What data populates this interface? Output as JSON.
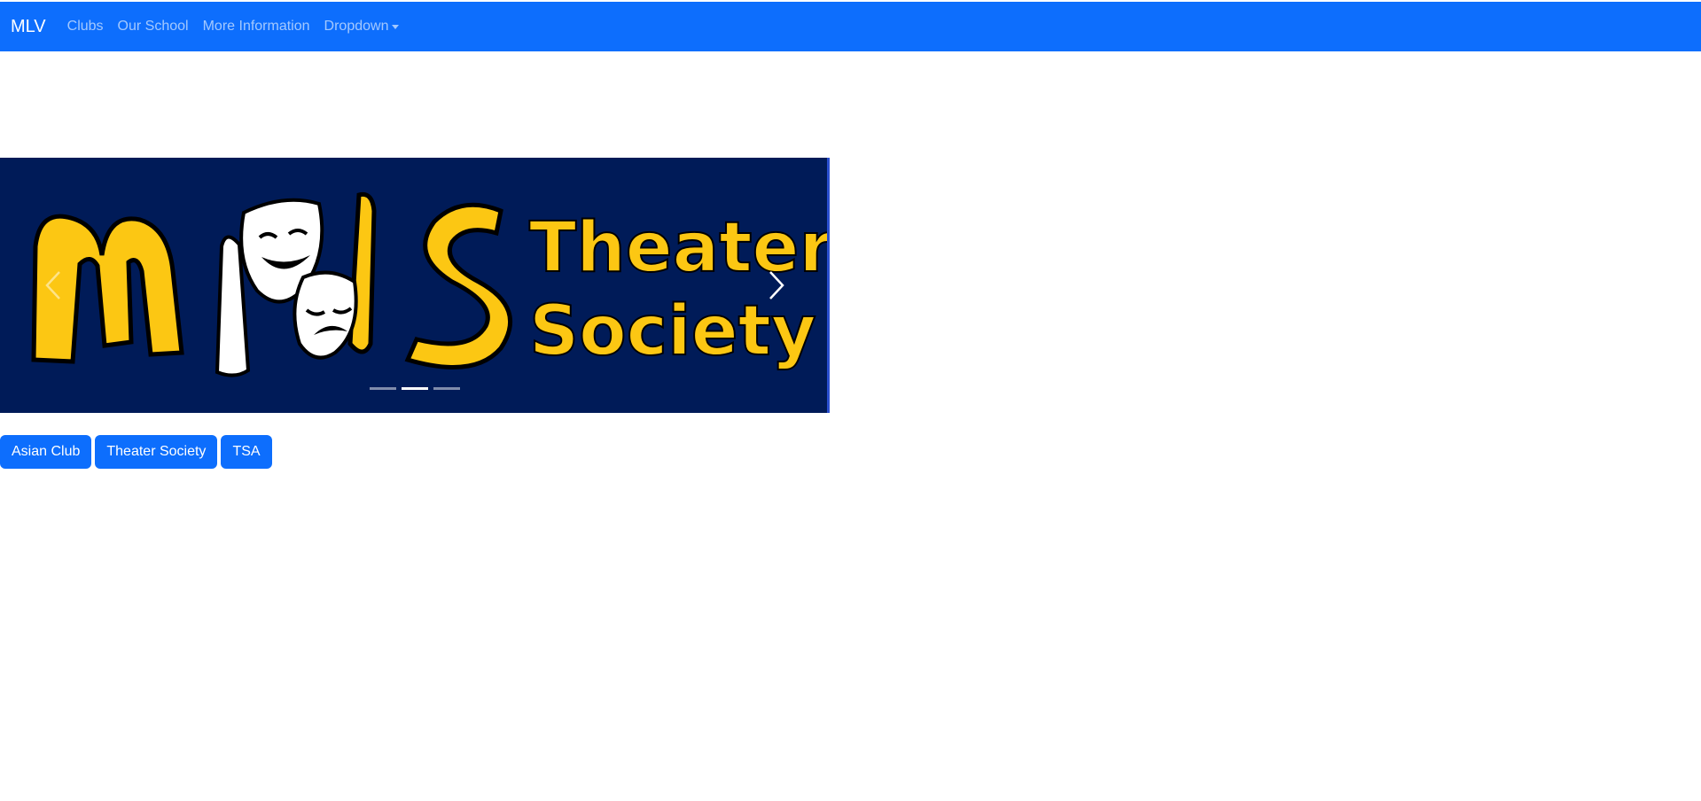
{
  "navbar": {
    "brand": "MLV",
    "links": [
      "Clubs",
      "Our School",
      "More Information"
    ],
    "dropdown_label": "Dropdown",
    "background_color": "#0d6efd"
  },
  "carousel": {
    "slide_title_initials": "MVS",
    "slide_title_line1": "Theater",
    "slide_title_line2": "Society",
    "background_color": "#001b58",
    "accent_color": "#fcc713",
    "active_slide": 2,
    "slide_count": 3,
    "prev_icon": "chevron-left-icon",
    "next_icon": "chevron-right-icon"
  },
  "club_buttons": [
    "Asian Club",
    "Theater Society",
    "TSA"
  ]
}
